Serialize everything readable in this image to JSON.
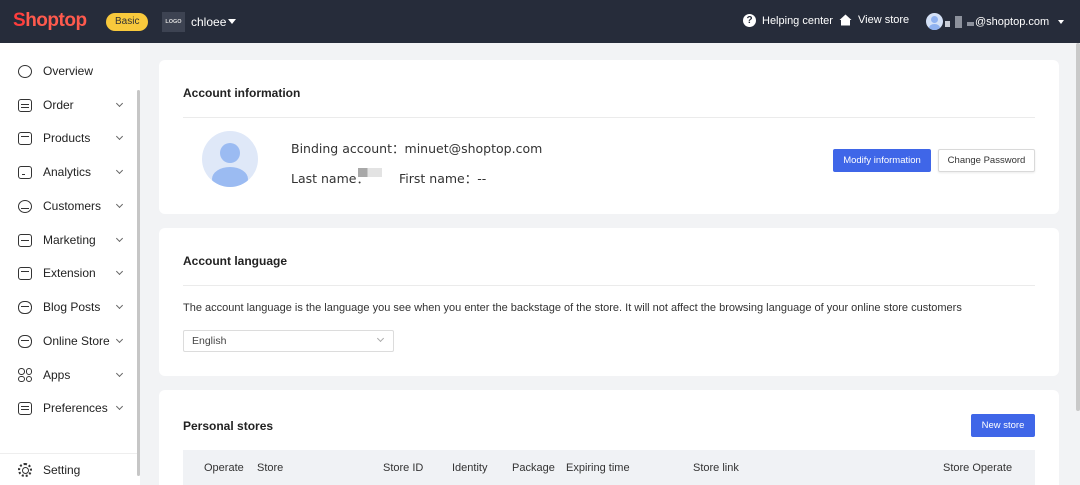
{
  "topbar": {
    "brand": "Shoptop",
    "plan_badge": "Basic",
    "store_logo": "LOGO",
    "store_name": "chloee",
    "help_label": "Helping center",
    "view_store_label": "View store",
    "user_email": "@shoptop.com"
  },
  "sidebar": {
    "items": [
      {
        "label": "Overview"
      },
      {
        "label": "Order"
      },
      {
        "label": "Products"
      },
      {
        "label": "Analytics"
      },
      {
        "label": "Customers"
      },
      {
        "label": "Marketing"
      },
      {
        "label": "Extension"
      },
      {
        "label": "Blog Posts"
      },
      {
        "label": "Online Store"
      },
      {
        "label": "Apps"
      },
      {
        "label": "Preferences"
      }
    ],
    "setting_label": "Setting"
  },
  "account_info": {
    "title": "Account information",
    "binding_label": "Binding account：",
    "binding_value": "minuet@shoptop.com",
    "last_name_label": "Last name：",
    "first_name_label": "First name：",
    "first_name_value": "--",
    "modify_button": "Modify information",
    "change_password_button": "Change Password"
  },
  "account_language": {
    "title": "Account language",
    "description": "The account language is the language you see when you enter the backstage of the store. It will not affect the browsing language of your online store customers",
    "selected_language": "English"
  },
  "personal_stores": {
    "title": "Personal stores",
    "new_store_button": "New store",
    "columns": [
      "Operate",
      "Store",
      "Store ID",
      "Identity",
      "Package",
      "Expiring time",
      "Store link",
      "Store Operate"
    ]
  },
  "colors": {
    "topbar_bg": "#262c3a",
    "primary": "#3f66e8",
    "badge": "#f8c93c",
    "brand_red": "#ff3d3d"
  }
}
